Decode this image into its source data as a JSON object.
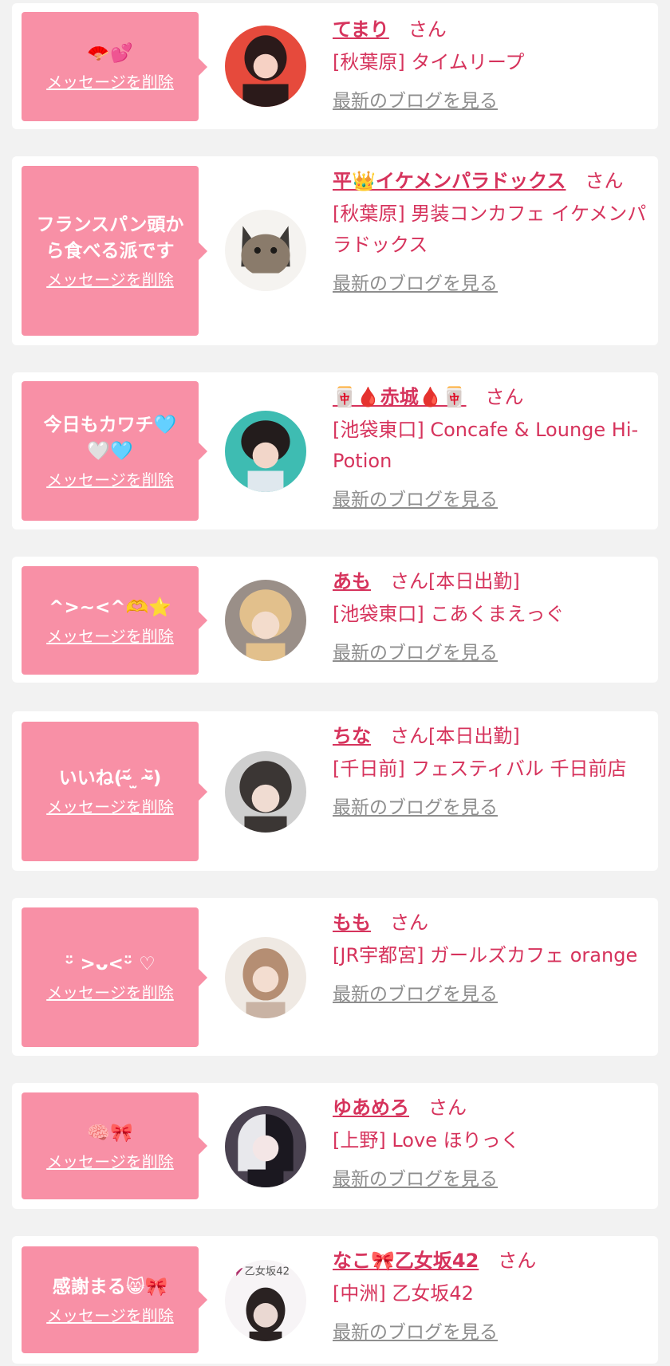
{
  "common": {
    "delete_label": "メッセージを削除",
    "blog_label": "最新のブログを見る",
    "honorific": "さん"
  },
  "cards": [
    {
      "message": "🪭💕",
      "name": "てまり",
      "status": "",
      "shop": "[秋葉原] タイムリープ",
      "avatar_colors": [
        "#e64a3c",
        "#2b1a1a",
        "#f6d1c4"
      ]
    },
    {
      "message": "フランスパン頭か\nら食べる派です",
      "name": "平👑イケメンパラドックス",
      "status": "",
      "shop": "[秋葉原] 男装コンカフェ イケメンパラドックス",
      "avatar_colors": [
        "#3d3a37",
        "#8a7b6b",
        "#f5f3f0"
      ]
    },
    {
      "message": "今日もカワチ🩵\n🤍🩵",
      "name": "🀄🩸赤城🩸🀄",
      "status": "",
      "shop": "[池袋東口] Concafe & Lounge Hi-Potion",
      "avatar_colors": [
        "#3ebcb2",
        "#231c1c",
        "#f2d6c9"
      ]
    },
    {
      "message": "^>~<^🫶⭐️",
      "name": "あも",
      "status": "[本日出勤]",
      "shop": "[池袋東口] こあくまえっぐ",
      "avatar_colors": [
        "#9a8f88",
        "#e2c08c",
        "#f3dccc"
      ]
    },
    {
      "message": "いいね(ᵕ̴᷄ ̫ ᵕ̴᷅)",
      "name": "ちな",
      "status": "[本日出勤]",
      "shop": "[千日前] フェスティバル 千日前店",
      "avatar_colors": [
        "#cfcfcf",
        "#3b3634",
        "#f0dcd2"
      ]
    },
    {
      "message": "ᵕ̈ >ᴗ<ᵕ̈ ♡",
      "name": "もも",
      "status": "",
      "shop": "[JR宇都宮] ガールズカフェ orange",
      "avatar_colors": [
        "#efe9e3",
        "#b58e73",
        "#f3ddd0"
      ]
    },
    {
      "message": "🧠🎀",
      "name": "ゆあめろ",
      "status": "",
      "shop": "[上野] Love ほりっく",
      "avatar_colors": [
        "#4a4250",
        "#e8e8ec",
        "#1b1820"
      ]
    },
    {
      "message": "感謝まる😸🎀",
      "name": "なこ🎀乙女坂42",
      "status": "",
      "shop": "[中洲] 乙女坂42",
      "avatar_colors": [
        "#f7f4f6",
        "#2a2222",
        "#ead8d2"
      ],
      "avatar_text": "乙女坂42"
    }
  ]
}
